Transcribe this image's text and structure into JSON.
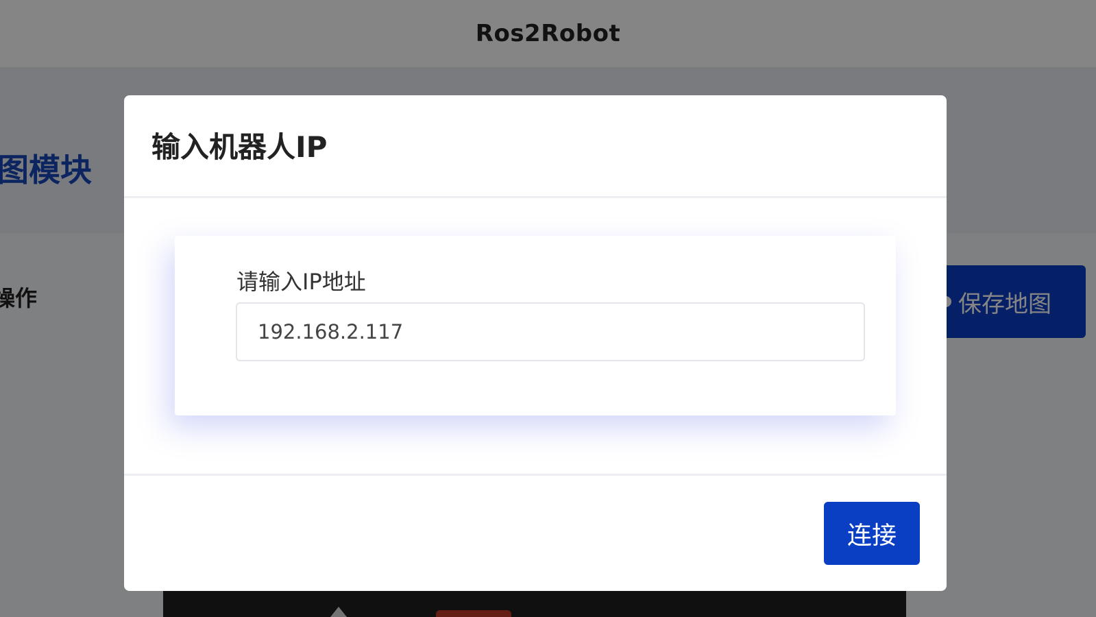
{
  "app": {
    "title": "Ros2Robot"
  },
  "background": {
    "module_title": "图模块",
    "ops_label": "操作",
    "save_map_button": "保存地图"
  },
  "dialog": {
    "title": "输入机器人IP",
    "ip_label": "请输入IP地址",
    "ip_value": "192.168.2.117",
    "connect_button": "连接"
  },
  "colors": {
    "primary": "#0a3fc4",
    "overlay": "rgba(0,0,0,0.48)",
    "module_title": "#1747b8",
    "card_shadow": "#7382eb"
  },
  "icons": {
    "save_map_bullet": "filled-circle"
  }
}
